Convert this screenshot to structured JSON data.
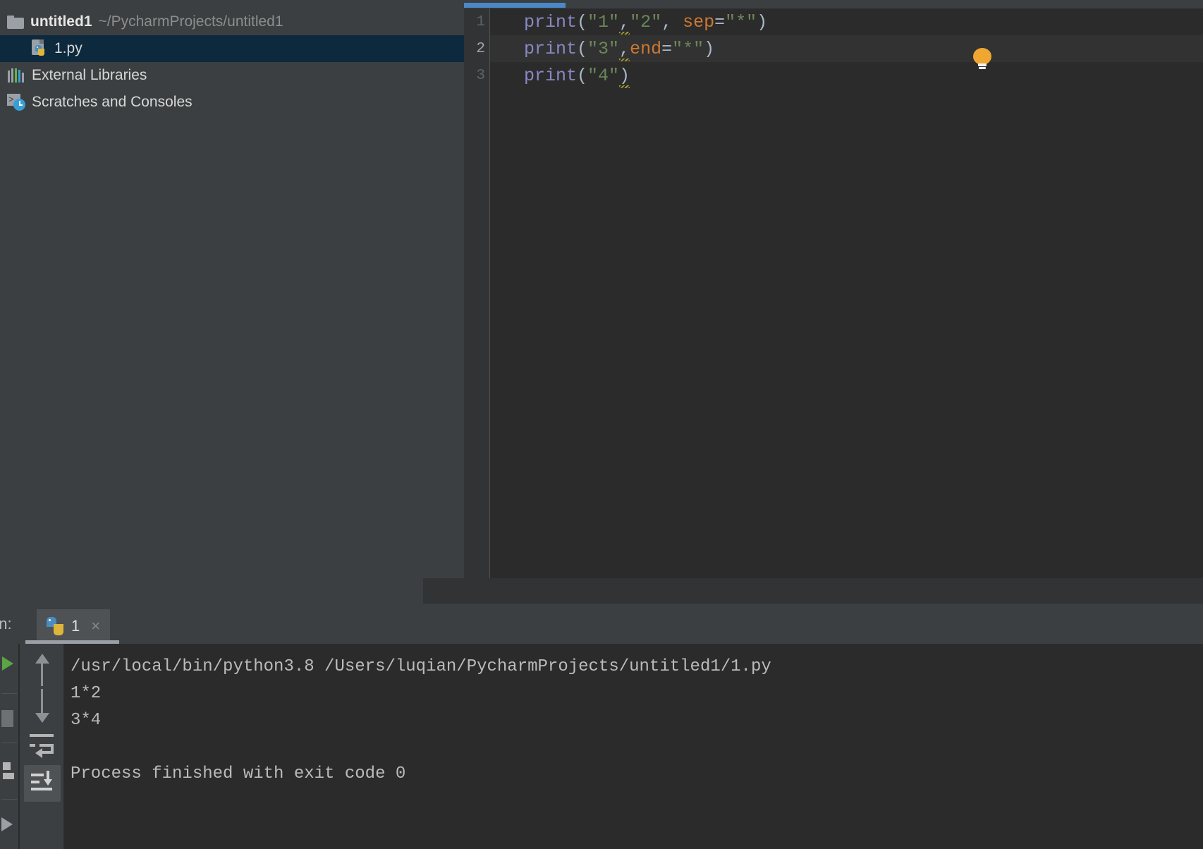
{
  "project": {
    "root_name": "untitled1",
    "root_path": "~/PycharmProjects/untitled1",
    "items": [
      {
        "label": "1.py",
        "icon": "python-file-icon"
      },
      {
        "label": "External Libraries",
        "icon": "external-libraries-icon"
      },
      {
        "label": "Scratches and Consoles",
        "icon": "scratches-icon"
      }
    ]
  },
  "editor": {
    "lines": [
      {
        "number": "1",
        "tokens": [
          {
            "t": "print",
            "c": "fn"
          },
          {
            "t": "(",
            "c": "paren"
          },
          {
            "t": "\"1\"",
            "c": "str"
          },
          {
            "t": ",",
            "c": "plain-err"
          },
          {
            "t": "\"2\"",
            "c": "str"
          },
          {
            "t": ", ",
            "c": "plain"
          },
          {
            "t": "sep",
            "c": "named"
          },
          {
            "t": "=",
            "c": "plain"
          },
          {
            "t": "\"*\"",
            "c": "str"
          },
          {
            "t": ")",
            "c": "paren"
          }
        ]
      },
      {
        "number": "2",
        "tokens": [
          {
            "t": "print",
            "c": "fn"
          },
          {
            "t": "(",
            "c": "paren"
          },
          {
            "t": "\"3\"",
            "c": "str"
          },
          {
            "t": ",",
            "c": "plain-err"
          },
          {
            "t": "end",
            "c": "named"
          },
          {
            "t": "=",
            "c": "plain"
          },
          {
            "t": "\"*\"",
            "c": "str"
          },
          {
            "t": ")",
            "c": "paren"
          }
        ]
      },
      {
        "number": "3",
        "tokens": [
          {
            "t": "print",
            "c": "fn"
          },
          {
            "t": "(",
            "c": "paren"
          },
          {
            "t": "\"4\"",
            "c": "str"
          },
          {
            "t": ")",
            "c": "paren-err"
          }
        ]
      }
    ],
    "line1_text": "print(\"1\",\"2\", sep=\"*\")",
    "line2_text": "print(\"3\",end=\"*\")",
    "line3_text": "print(\"4\")",
    "intention_bulb": "intention-bulb-icon"
  },
  "run_panel": {
    "title": "un:",
    "tab_label": "1",
    "tab_close": "×",
    "console_lines": [
      "/usr/local/bin/python3.8 /Users/luqian/PycharmProjects/untitled1/1.py",
      "1*2",
      "3*4",
      "",
      "Process finished with exit code 0"
    ]
  },
  "colors": {
    "accent_blue": "#4a88c7",
    "selection_blue": "#0d293e",
    "editor_bg": "#2b2b2b",
    "panel_bg": "#3c3f41",
    "string_green": "#6a8759",
    "keyword_orange": "#cc7832",
    "function_purple": "#8888c6"
  }
}
